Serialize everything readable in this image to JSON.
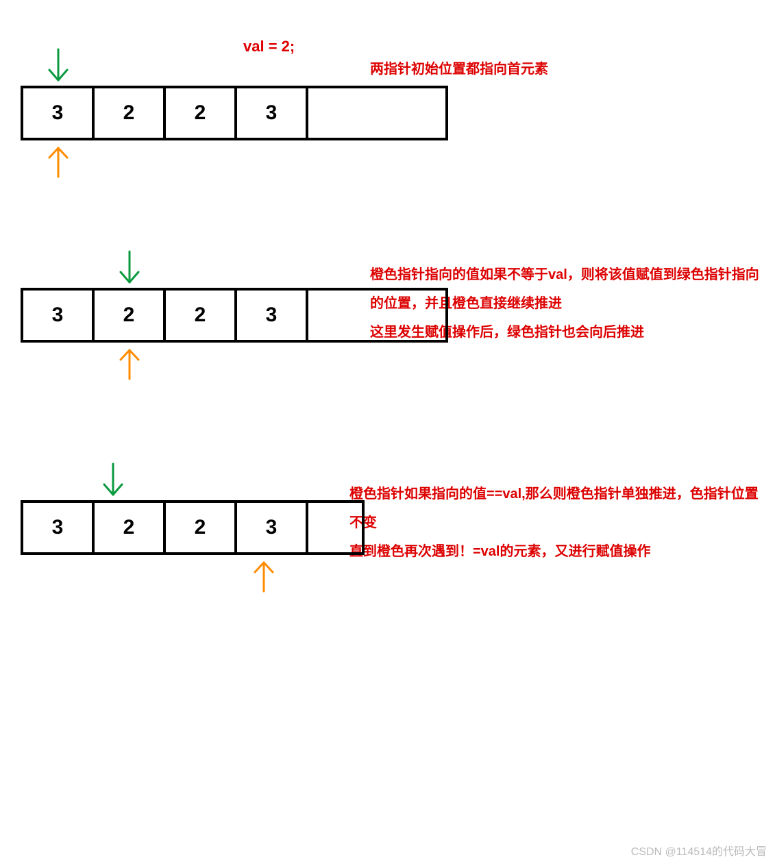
{
  "title": "val = 2;",
  "watermark": "CSDN @114514的代码大冒",
  "step1": {
    "cells": [
      "3",
      "2",
      "2",
      "3",
      ""
    ],
    "caption": "两指针初始位置都指向首元素",
    "greenIndex": 0,
    "orangeIndex": 0
  },
  "step2": {
    "cells": [
      "3",
      "2",
      "2",
      "3",
      ""
    ],
    "caption": "橙色指针指向的值如果不等于val，则将该值赋值到绿色指针指向的位置，并且橙色直接继续推进\n这里发生赋值操作后，绿色指针也会向后推进",
    "greenIndex": 1,
    "orangeIndex": 1
  },
  "step3": {
    "cells": [
      "3",
      "2",
      "2",
      "3",
      ""
    ],
    "caption": "橙色指针如果指向的值==val,那么则橙色指针单独推进，色指针位置不变\n直到橙色再次遇到！=val的元素，又进行赋值操作",
    "greenIndex": 1,
    "orangeIndex": 3
  }
}
